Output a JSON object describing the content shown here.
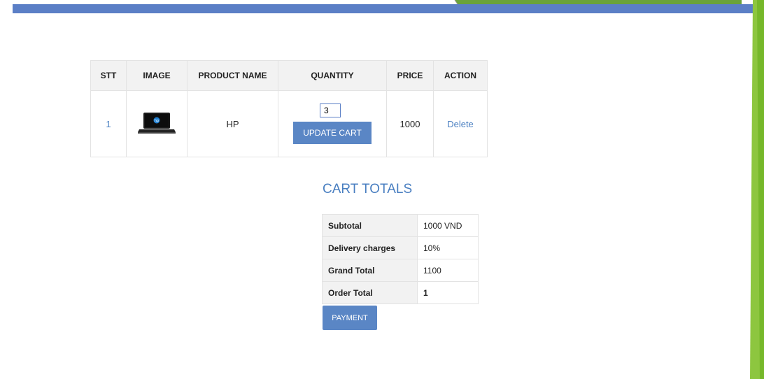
{
  "cart": {
    "headers": {
      "stt": "STT",
      "image": "IMAGE",
      "product_name": "PRODUCT NAME",
      "quantity": "QUANTITY",
      "price": "PRICE",
      "action": "ACTION"
    },
    "rows": [
      {
        "stt": "1",
        "image_icon": "laptop-icon",
        "product_name": "HP",
        "quantity": "3",
        "update_label": "UPDATE CART",
        "price": "1000",
        "action_label": "Delete"
      }
    ]
  },
  "totals": {
    "title": "CART TOTALS",
    "rows": [
      {
        "label": "Subtotal",
        "value": "1000 VND"
      },
      {
        "label": "Delivery charges",
        "value": "10%"
      },
      {
        "label": "Grand Total",
        "value": "1100"
      },
      {
        "label": "Order Total",
        "value": "1"
      }
    ],
    "payment_label": "PAYMENT"
  },
  "colors": {
    "accent": "#5a86c5",
    "link": "#4a7fc1",
    "top_bar": "#5b7fc6",
    "decoration_green": "#8dc63f"
  }
}
